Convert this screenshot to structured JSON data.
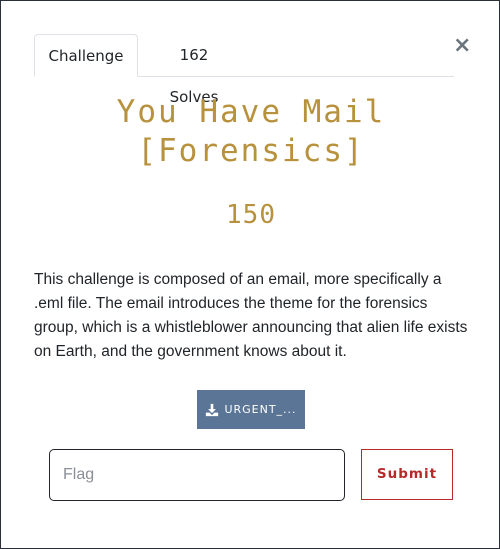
{
  "modal": {
    "tabs": [
      {
        "label": "Challenge"
      },
      {
        "label": "162 Solves"
      }
    ],
    "close_label": "×",
    "title": "You Have Mail [Forensics]",
    "value": "150",
    "description": "This challenge is composed of an email, more specifically a .eml file. The email introduces the theme for the forensics group, which is a whistleblower announcing that alien life exists on Earth, and the government knows about it.",
    "file_button_label": "URGENT_...",
    "file_button_icon": "download-icon",
    "flag_input": {
      "placeholder": "Flag",
      "value": ""
    },
    "submit_label": "Submit"
  },
  "colors": {
    "accent": "#b8913d",
    "file_button": "#5b7596",
    "submit": "#b52a2a"
  }
}
